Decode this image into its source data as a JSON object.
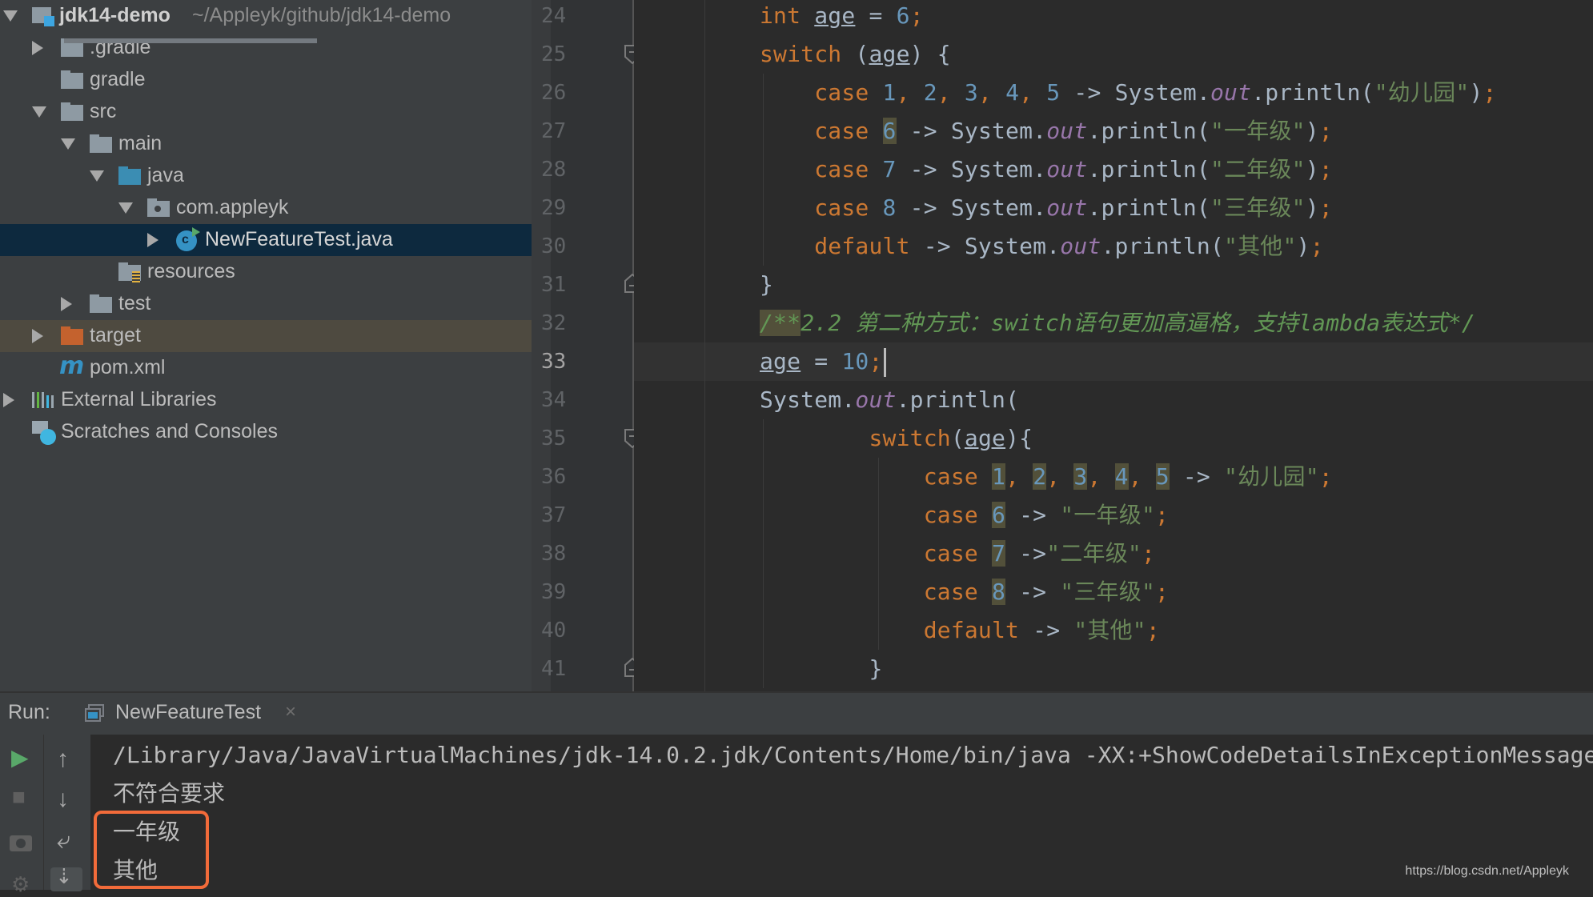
{
  "project_tree": {
    "root": {
      "name": "jdk14-demo",
      "path": "~/Appleyk/github/jdk14-demo"
    },
    "items": [
      {
        "label": ".gradle",
        "icon": "folder-icon",
        "expanded": false
      },
      {
        "label": "gradle",
        "icon": "folder-icon"
      },
      {
        "label": "src",
        "icon": "folder-icon",
        "expanded": true
      },
      {
        "label": "main",
        "icon": "folder-icon",
        "expanded": true
      },
      {
        "label": "java",
        "icon": "source-folder-icon",
        "expanded": true
      },
      {
        "label": "com.appleyk",
        "icon": "package-icon",
        "expanded": true
      },
      {
        "label": "NewFeatureTest.java",
        "icon": "java-class-icon",
        "expanded": false,
        "selected": true
      },
      {
        "label": "resources",
        "icon": "resources-folder-icon"
      },
      {
        "label": "test",
        "icon": "folder-icon",
        "expanded": false
      },
      {
        "label": "target",
        "icon": "excluded-folder-icon",
        "expanded": false
      },
      {
        "label": "pom.xml",
        "icon": "maven-icon"
      },
      {
        "label": "External Libraries",
        "icon": "libraries-icon",
        "expanded": false
      },
      {
        "label": "Scratches and Consoles",
        "icon": "scratches-icon"
      }
    ]
  },
  "editor": {
    "current_line": 33,
    "line_numbers": [
      "24",
      "25",
      "26",
      "27",
      "28",
      "29",
      "30",
      "31",
      "32",
      "33",
      "34",
      "35",
      "36",
      "37",
      "38",
      "39",
      "40",
      "41"
    ],
    "lines": [
      "int age = 6;",
      "switch (age) {",
      "    case 1, 2, 3, 4, 5 -> System.out.println(\"幼儿园\");",
      "    case 6 -> System.out.println(\"一年级\");",
      "    case 7 -> System.out.println(\"二年级\");",
      "    case 8 -> System.out.println(\"三年级\");",
      "    default -> System.out.println(\"其他\");",
      "}",
      "/**2.2 第二种方式：switch语句更加高逼格，支持lambda表达式*/",
      "age = 10;",
      "System.out.println(",
      "        switch(age){",
      "            case 1, 2, 3, 4, 5 -> \"幼儿园\";",
      "            case 6 -> \"一年级\";",
      "            case 7 ->\"二年级\";",
      "            case 8 -> \"三年级\";",
      "            default -> \"其他\";",
      "        }"
    ],
    "tokens": {
      "int": "int",
      "switch": "switch",
      "case": "case",
      "default": "default",
      "age": "age",
      "system": "System",
      "out": "out",
      "println": "println",
      "n6": "6",
      "n7": "7",
      "n8": "8",
      "n10": "10",
      "n1": "1",
      "n2": "2",
      "n3": "3",
      "n4": "4",
      "n5": "5",
      "s_kg": "\"幼儿园\"",
      "s_g1": "\"一年级\"",
      "s_g2": "\"二年级\"",
      "s_g3": "\"三年级\"",
      "s_other": "\"其他\"",
      "comment_open": "/**",
      "comment_body": "2.2 第二种方式：switch语句更加高逼格，支持lambda表达式*/"
    }
  },
  "run_panel": {
    "label": "Run:",
    "tab": {
      "label": "NewFeatureTest",
      "close": "×"
    },
    "console_lines": [
      "/Library/Java/JavaVirtualMachines/jdk-14.0.2.jdk/Contents/Home/bin/java -XX:+ShowCodeDetailsInExceptionMessages",
      "不符合要求",
      "一年级",
      "其他"
    ],
    "highlighted_lines": [
      "一年级",
      "其他"
    ],
    "toolbar": {
      "run": "▶",
      "stop": "■",
      "up": "↑",
      "down": "↓",
      "wrap": "⤶",
      "scroll_end": "⇣"
    }
  },
  "watermark": "https://blog.csdn.net/Appleyk",
  "colors": {
    "keyword": "#CC7832",
    "number": "#6897BB",
    "string": "#6A8759",
    "field": "#9876AA",
    "comment": "#629755",
    "highlight_box": "#F26B3A",
    "selection": "#0D293E"
  }
}
